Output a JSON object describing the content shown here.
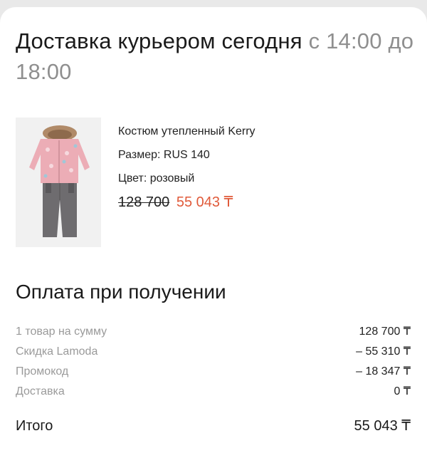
{
  "delivery": {
    "title_main": "Доставка курьером сегодня",
    "title_time": "с 14:00 до 18:00"
  },
  "product": {
    "image_icon": "snowsuit-product-image",
    "name": "Костюм утепленный Kerry",
    "size": "Размер: RUS 140",
    "color": "Цвет: розовый",
    "old_price": "128 700",
    "new_price": "55 043 ₸",
    "price_accent_color": "#e05a3a"
  },
  "payment": {
    "title": "Оплата при получении",
    "rows": [
      {
        "label": "1 товар на сумму",
        "value": "128 700 ₸"
      },
      {
        "label": "Скидка Lamoda",
        "value": "– 55 310 ₸"
      },
      {
        "label": "Промокод",
        "value": "– 18 347 ₸"
      },
      {
        "label": "Доставка",
        "value": "0 ₸"
      }
    ],
    "total_label": "Итого",
    "total_value": "55 043 ₸"
  }
}
